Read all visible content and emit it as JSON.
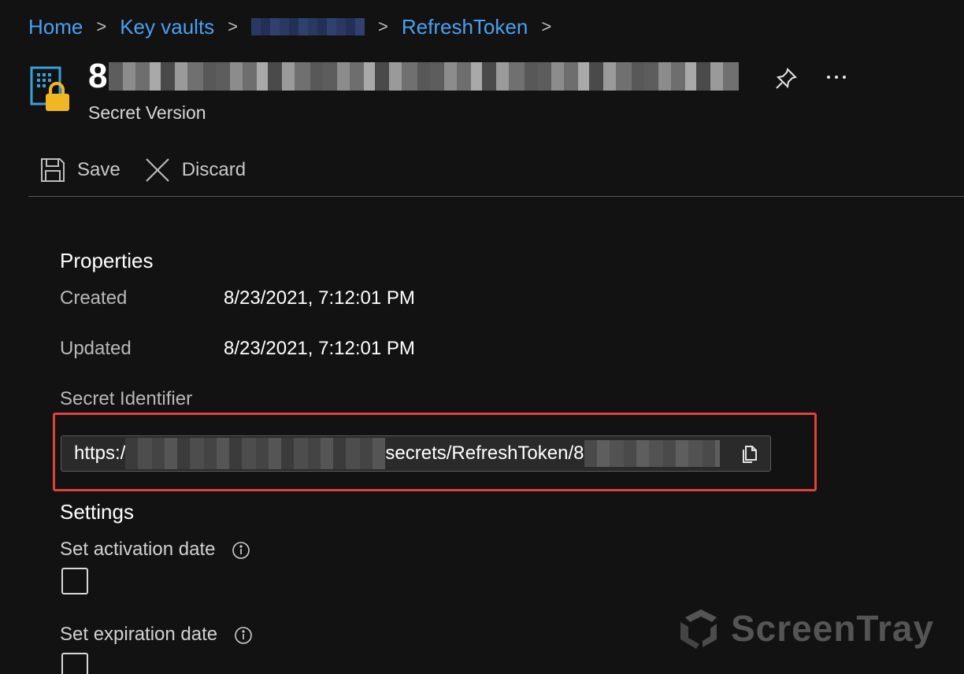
{
  "breadcrumb": {
    "items": [
      "Home",
      "Key vaults",
      "RefreshToken"
    ],
    "separator": ">"
  },
  "header": {
    "title_prefix": "8",
    "subtitle": "Secret Version"
  },
  "toolbar": {
    "save_label": "Save",
    "discard_label": "Discard"
  },
  "properties": {
    "heading": "Properties",
    "created_label": "Created",
    "created_value": "8/23/2021, 7:12:01 PM",
    "updated_label": "Updated",
    "updated_value": "8/23/2021, 7:12:01 PM",
    "identifier_label": "Secret Identifier",
    "identifier_prefix": "https:/",
    "identifier_middle": "secrets/RefreshToken/8",
    "identifier_suffix": ""
  },
  "settings": {
    "heading": "Settings",
    "activation_label": "Set activation date",
    "expiration_label": "Set expiration date"
  },
  "watermark": {
    "text": "ScreenTray"
  },
  "colors": {
    "background": "#121212",
    "link": "#4aa0f0",
    "highlight": "#e0413a",
    "lock": "#f3b623",
    "vault_icon": "#3aa0d8"
  },
  "icons": [
    "key-vault-secret-icon",
    "pin-icon",
    "more-icon",
    "save-icon",
    "discard-icon",
    "copy-icon",
    "info-icon"
  ]
}
